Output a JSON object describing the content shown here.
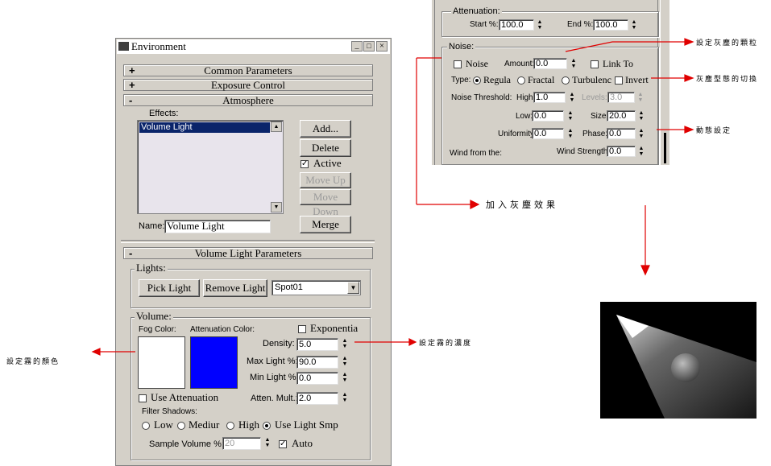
{
  "env_window": {
    "title": "Environment",
    "title_buttons": [
      "_",
      "□",
      "×"
    ],
    "rollouts": {
      "common": {
        "sign": "+",
        "title": "Common Parameters"
      },
      "exposure": {
        "sign": "+",
        "title": "Exposure Control"
      },
      "atmosphere": {
        "sign": "-",
        "title": "Atmosphere"
      }
    },
    "effects_label": "Effects:",
    "effects_list": [
      "Volume Light"
    ],
    "buttons": {
      "add": "Add...",
      "delete": "Delete",
      "move_up": "Move Up",
      "move_down": "Move Down",
      "merge": "Merge"
    },
    "active": {
      "label": "Active",
      "checked": true
    },
    "name_label": "Name:",
    "name_value": "Volume Light",
    "vl_rollout": {
      "sign": "-",
      "title": "Volume Light Parameters"
    },
    "lights": {
      "group": "Lights:",
      "pick": "Pick Light",
      "remove": "Remove Light",
      "selected": "Spot01"
    },
    "volume": {
      "group": "Volume:",
      "fog_color_label": "Fog Color:",
      "fog_color": "#ffffff",
      "atten_color_label": "Attenuation Color:",
      "atten_color": "#0000ff",
      "exponential_label": "Exponentia",
      "density_label": "Density:",
      "density": "5.0",
      "max_light_label": "Max Light %:",
      "max_light": "90.0",
      "min_light_label": "Min Light %:",
      "min_light": "0.0",
      "use_atten_label": "Use Attenuation",
      "atten_mult_label": "Atten. Mult.:",
      "atten_mult": "2.0",
      "filter_shadows_label": "Filter Shadows:",
      "shadow_options": [
        "Low",
        "Mediur",
        "High",
        "Use Light Smp"
      ],
      "shadow_selected": "High",
      "sample_volume_label": "Sample Volume %:",
      "sample_volume": "20",
      "auto_label": "Auto",
      "auto_checked": true
    }
  },
  "noise_panel": {
    "attenuation_group": "Attenuation:",
    "start_label": "Start %:",
    "start_value": "100.0",
    "end_label": "End %:",
    "end_value": "100.0",
    "noise_group": "Noise:",
    "noise_label": "Noise",
    "amount_label": "Amount:",
    "amount_value": "0.0",
    "link_to_label": "Link To",
    "type_label": "Type:",
    "type_options": [
      "Regula",
      "Fractal",
      "Turbulenc"
    ],
    "type_selected": "Regula",
    "invert_label": "Invert",
    "threshold_label": "Noise Threshold:",
    "high_label": "High:",
    "high_value": "1.0",
    "levels_label": "Levels:",
    "levels_value": "3.0",
    "low_label": "Low:",
    "low_value": "0.0",
    "size_label": "Size:",
    "size_value": "20.0",
    "uniformity_label": "Uniformity:",
    "uniformity_value": "0.0",
    "phase_label": "Phase:",
    "phase_value": "0.0",
    "wind_from_label": "Wind from the:",
    "wind_strength_label": "Wind Strength:",
    "wind_strength_value": "0.0"
  },
  "annotations": {
    "dust_particle": "設定灰塵的顆粒",
    "dust_type": "灰塵型態的切換",
    "dynamic": "動態設定",
    "add_dust": "加入灰塵效果",
    "fog_density": "設定霧的濃度",
    "fog_color": "設定霧的顏色"
  },
  "colors": {
    "dialog_bg": "#d4d0c8",
    "title_bar": "#0a246a",
    "arrow": "#e00000",
    "list_selected": "#0a246a"
  }
}
